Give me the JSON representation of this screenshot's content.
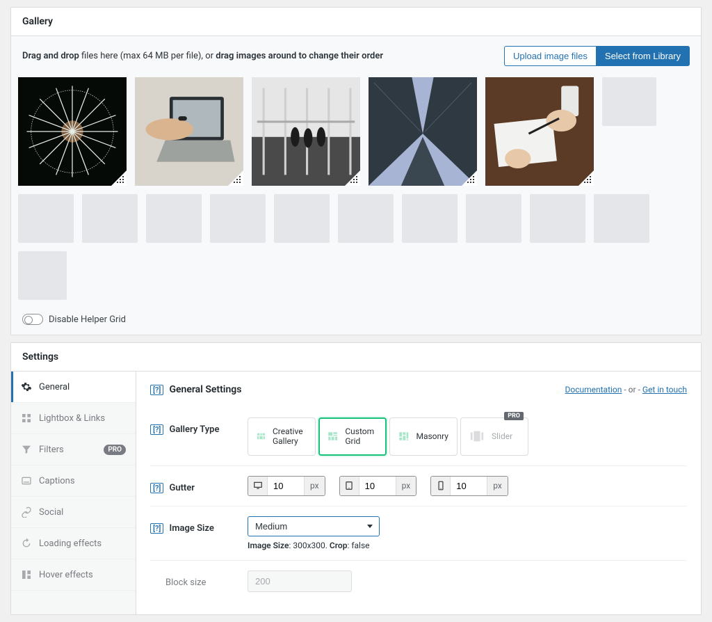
{
  "gallery": {
    "title": "Gallery",
    "drop_prefix_bold": "Drag and drop",
    "drop_mid": " files here (max 64 MB per file), or ",
    "drop_suffix_bold": "drag images around to change their order",
    "upload_btn": "Upload image files",
    "library_btn": "Select from Library",
    "helper_toggle_label": "Disable Helper Grid"
  },
  "settings": {
    "title": "Settings",
    "tabs": [
      {
        "label": "General",
        "icon": "gear",
        "active": true
      },
      {
        "label": "Lightbox & Links",
        "icon": "grid"
      },
      {
        "label": "Filters",
        "icon": "funnel",
        "pro": "PRO"
      },
      {
        "label": "Captions",
        "icon": "caption"
      },
      {
        "label": "Social",
        "icon": "link"
      },
      {
        "label": "Loading effects",
        "icon": "refresh"
      },
      {
        "label": "Hover effects",
        "icon": "hover"
      }
    ],
    "section_title": "General Settings",
    "doc_link": "Documentation",
    "or_text": "  - or -  ",
    "contact_link": "Get in touch",
    "gallery_type": {
      "label": "Gallery Type",
      "options": [
        {
          "label": "Creative Gallery"
        },
        {
          "label": "Custom Grid",
          "selected": true
        },
        {
          "label": "Masonry"
        },
        {
          "label": "Slider",
          "pro": "PRO"
        }
      ]
    },
    "gutter": {
      "label": "Gutter",
      "fields": [
        {
          "device": "desktop",
          "value": "10",
          "unit": "px"
        },
        {
          "device": "tablet",
          "value": "10",
          "unit": "px"
        },
        {
          "device": "phone",
          "value": "10",
          "unit": "px"
        }
      ]
    },
    "image_size": {
      "label": "Image Size",
      "selected": "Medium",
      "hint_prefix": "Image Size",
      "hint_dims": ": 300x300. ",
      "hint_crop_label": "Crop",
      "hint_crop_val": ": false"
    },
    "block_size": {
      "label": "Block size",
      "value": "200"
    }
  }
}
